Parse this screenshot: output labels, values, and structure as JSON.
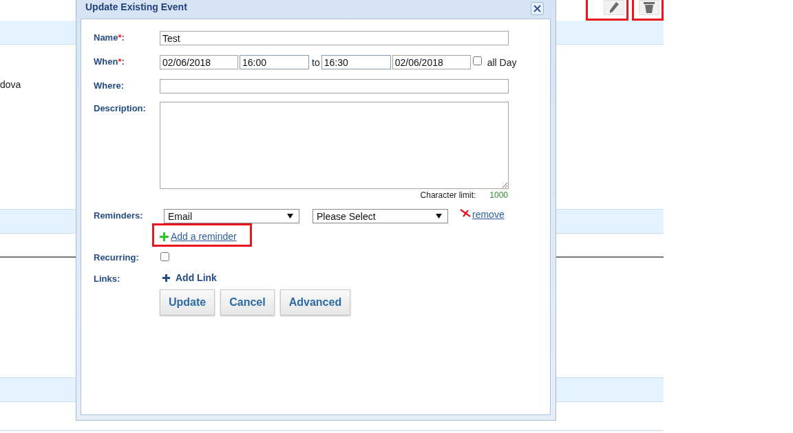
{
  "toolbar": {
    "buttons": [
      {
        "kind": "edit",
        "highlighted": true
      },
      {
        "kind": "delete",
        "highlighted": true
      }
    ]
  },
  "list": {
    "cells": [
      "dova"
    ]
  },
  "dialog": {
    "title": "Update Existing Event",
    "name": {
      "label": "Name",
      "required_mark": "*",
      "colon": ":",
      "value": "Test"
    },
    "when": {
      "label": "When",
      "required_mark": "*",
      "colon": ":",
      "start_date": "02/06/2018",
      "start_time": "16:00",
      "separator": "to",
      "end_time": "16:30",
      "end_date": "02/06/2018",
      "all_day": {
        "label": "all Day",
        "checked": false
      }
    },
    "where": {
      "label": "Where:"
    },
    "description": {
      "label": "Description:",
      "limit_label": "Character limit:",
      "limit_value": "1000"
    },
    "reminders": {
      "label": "Reminders:",
      "items": [
        {
          "method": "Email",
          "time": "Please Select",
          "remove": "remove"
        }
      ],
      "add": {
        "label": "Add a reminder",
        "highlighted": true
      }
    },
    "recurring": {
      "label": "Recurring:",
      "checked": false
    },
    "links": {
      "label": "Links:",
      "add": "Add Link"
    },
    "buttons": [
      "Update",
      "Cancel",
      "Advanced"
    ]
  }
}
